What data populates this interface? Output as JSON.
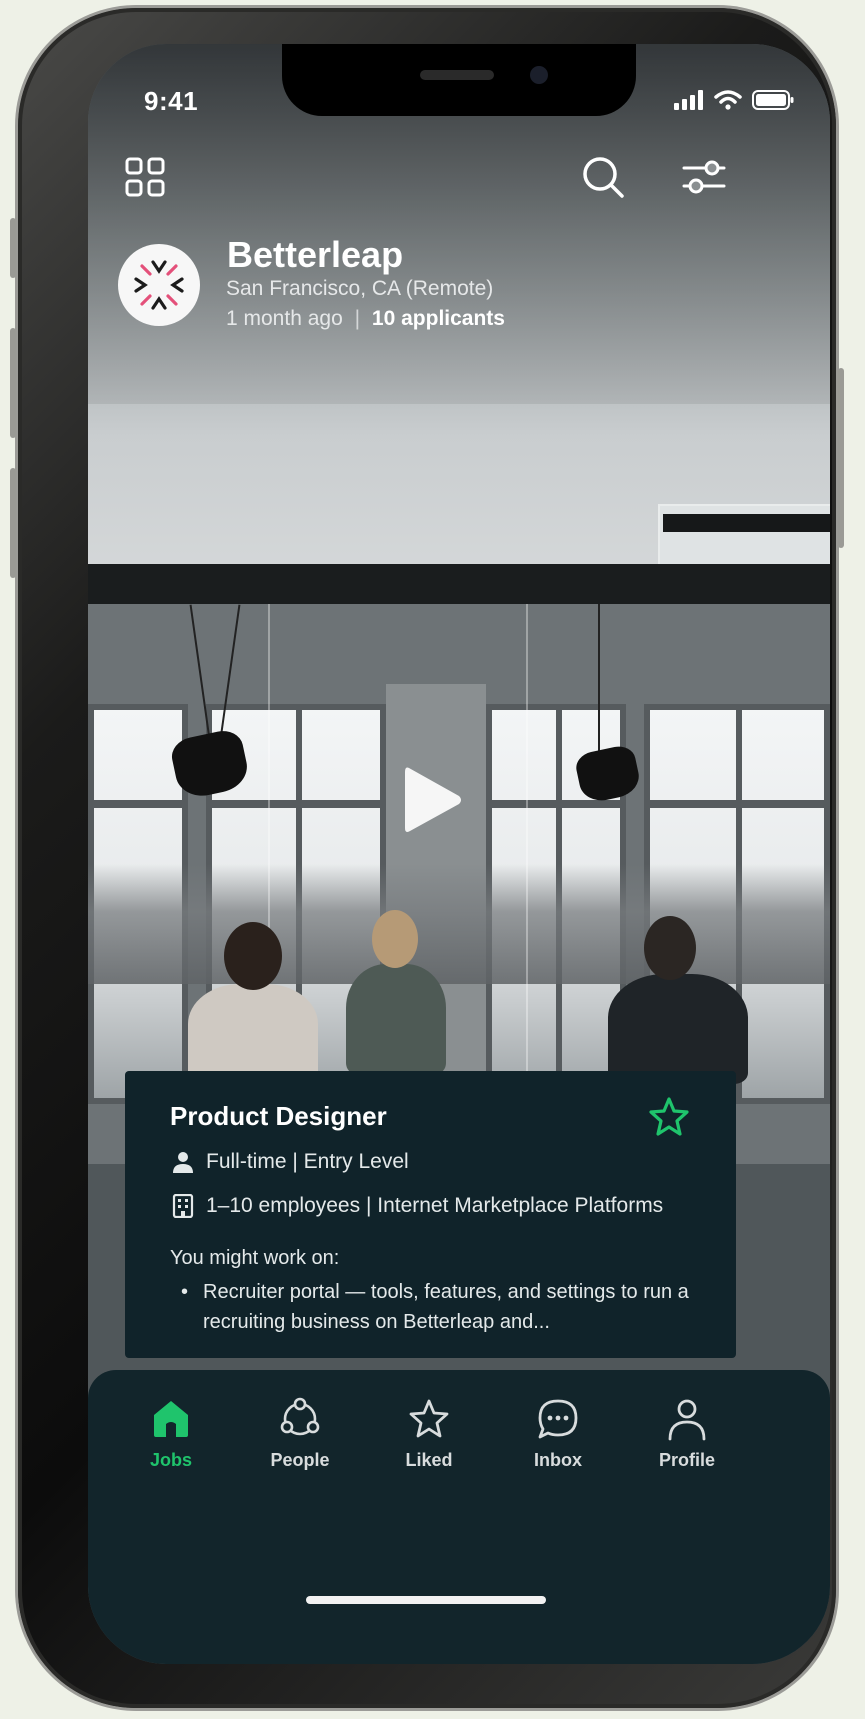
{
  "status_bar": {
    "time": "9:41"
  },
  "top_bar": {
    "menu_icon": "grid-icon",
    "search_icon": "search-icon",
    "filter_icon": "sliders-icon"
  },
  "company": {
    "name": "Betterleap",
    "location": "San Francisco, CA (Remote)",
    "posted": "1 month ago",
    "separator": "|",
    "applicants": "10 applicants"
  },
  "video": {
    "play_icon": "play-icon"
  },
  "job": {
    "title": "Product Designer",
    "type": "Full-time | Entry Level",
    "company_info": "1–10 employees | Internet Marketplace Platforms",
    "work_label": "You might work on:",
    "work_items": [
      "Recruiter portal — tools, features, and settings to run a recruiting business on Betterleap and..."
    ],
    "bullet": "•"
  },
  "tabs": [
    {
      "label": "Jobs",
      "icon": "home-icon",
      "active": true
    },
    {
      "label": "People",
      "icon": "people-icon",
      "active": false
    },
    {
      "label": "Liked",
      "icon": "star-icon",
      "active": false
    },
    {
      "label": "Inbox",
      "icon": "chat-icon",
      "active": false
    },
    {
      "label": "Profile",
      "icon": "profile-icon",
      "active": false
    }
  ],
  "colors": {
    "accent": "#1fc46c",
    "card_bg": "#10232a",
    "tab_bar_bg": "#12252b"
  }
}
